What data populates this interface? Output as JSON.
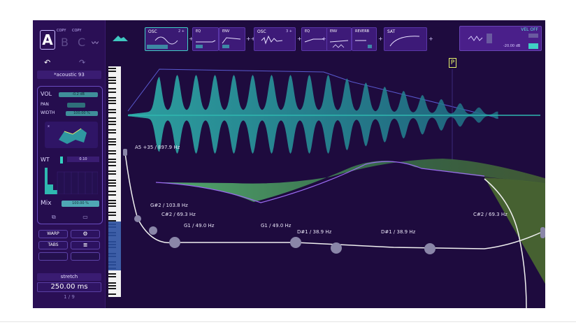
{
  "presets": {
    "current": "A",
    "others": [
      "B",
      "C"
    ],
    "copy_labels": [
      "COPY",
      "COPY"
    ],
    "preset_name": "*acoustic 93"
  },
  "voice": {
    "vol_label": "VOL",
    "vol_value": "-0.2 dB",
    "pan_label": "PAN",
    "width_label": "WIDTH",
    "width_value": "100.00 %",
    "wt_label": "WT",
    "wt_value": "0.10",
    "mix_label": "Mix",
    "mix_value": "100.00 %",
    "vol_fill": 0.6,
    "pan_fill": 0.5,
    "width_fill": 1.0
  },
  "fx": {
    "buttons": [
      "WARP",
      "TABS"
    ]
  },
  "stretch": {
    "label": "stretch",
    "value": "250.00 ms",
    "page": "1 / 9"
  },
  "modules": [
    {
      "title": "OSC",
      "sub": "2 +"
    },
    {
      "title": "EQ",
      "sub": ""
    },
    {
      "title": "ENV",
      "sub": ""
    },
    {
      "title": "OSC",
      "sub": "3 +"
    },
    {
      "title": "EQ",
      "sub": ""
    },
    {
      "title": "ENV",
      "sub": ""
    },
    {
      "title": "REVERB",
      "sub": ""
    },
    {
      "title": "SAT",
      "sub": ""
    }
  ],
  "right_box": {
    "vel_label": "VEL OFF",
    "time": "-20.00 dB"
  },
  "marker": "P",
  "notes": [
    "A5 +35 / 897.9 Hz",
    "G#2 / 103.8 Hz",
    "C#2 / 69.3 Hz",
    "G1 / 49.0 Hz",
    "G1 / 49.0 Hz",
    "D#1 / 38.9 Hz",
    "D#1 / 38.9 Hz",
    "C#2 / 69.3 Hz"
  ],
  "colors": {
    "background": "#1e0b3e",
    "panel": "#2a0f55",
    "teal": "#2fb8b0",
    "green": "#4fd06a",
    "accent": "#3fd0c5"
  }
}
